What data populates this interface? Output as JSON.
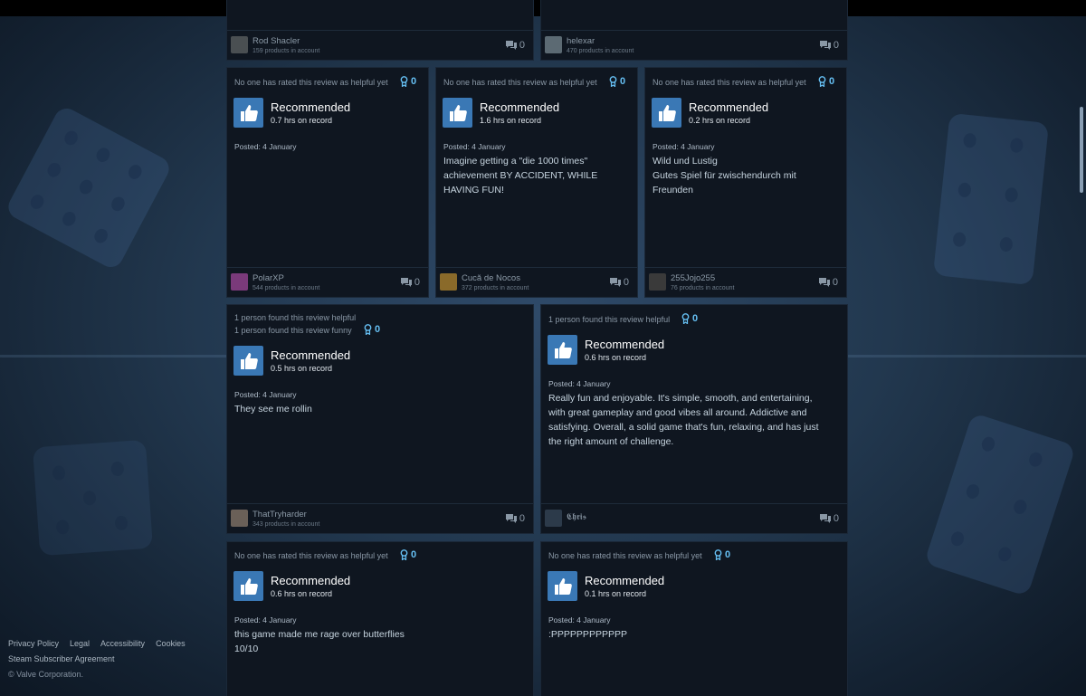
{
  "colors": {
    "accent": "#66c0f4",
    "thumb_bg": "#3a78b5",
    "card_bg": "#0f1620"
  },
  "top_cards": [
    {
      "user": "Rod Shacler",
      "products": "159 products in account",
      "comments": "0"
    },
    {
      "user": "helexar",
      "products": "470 products in account",
      "comments": "0"
    }
  ],
  "row1": [
    {
      "helpful": "No one has rated this review as helpful yet",
      "awards": "0",
      "recommendation": "Recommended",
      "hours": "0.7 hrs on record",
      "posted": "Posted: 4 January",
      "text": "",
      "user": "PolarXP",
      "products": "544 products in account",
      "comments": "0"
    },
    {
      "helpful": "No one has rated this review as helpful yet",
      "awards": "0",
      "recommendation": "Recommended",
      "hours": "1.6 hrs on record",
      "posted": "Posted: 4 January",
      "text": "Imagine getting a \"die 1000 times\"\nachievement BY ACCIDENT, WHILE\nHAVING FUN!",
      "user": "Cucă de Nocos",
      "products": "372 products in account",
      "comments": "0"
    },
    {
      "helpful": "No one has rated this review as helpful yet",
      "awards": "0",
      "recommendation": "Recommended",
      "hours": "0.2 hrs on record",
      "posted": "Posted: 4 January",
      "text": "Wild und Lustig\nGutes Spiel für zwischendurch mit\nFreunden",
      "user": "255Jojo255",
      "products": "76 products in account",
      "comments": "0"
    }
  ],
  "row2": [
    {
      "helpful": "1 person found this review helpful",
      "funny": "1 person found this review funny",
      "awards": "0",
      "recommendation": "Recommended",
      "hours": "0.5 hrs on record",
      "posted": "Posted: 4 January",
      "text": "They see me rollin",
      "user": "ThatTryharder",
      "products": "343 products in account",
      "comments": "0"
    },
    {
      "helpful": "1 person found this review helpful",
      "awards": "0",
      "recommendation": "Recommended",
      "hours": "0.6 hrs on record",
      "posted": "Posted: 4 January",
      "text": "Really fun and enjoyable. It's simple, smooth, and entertaining,\nwith great gameplay and good vibes all around. Addictive and\nsatisfying. Overall, a solid game that's fun, relaxing, and has just\nthe right amount of challenge.",
      "user": "𝕮𝖍𝖗𝖎𝖘",
      "comments": "0"
    }
  ],
  "row3": [
    {
      "helpful": "No one has rated this review as helpful yet",
      "awards": "0",
      "recommendation": "Recommended",
      "hours": "0.6 hrs on record",
      "posted": "Posted: 4 January",
      "text": "this game made me rage over butterflies\n10/10"
    },
    {
      "helpful": "No one has rated this review as helpful yet",
      "awards": "0",
      "recommendation": "Recommended",
      "hours": "0.1 hrs on record",
      "posted": "Posted: 4 January",
      "text": ":PPPPPPPPPPPP"
    }
  ],
  "footer": {
    "links": [
      "Privacy Policy",
      "Legal",
      "Accessibility",
      "Cookies"
    ],
    "subscriber": "Steam Subscriber Agreement",
    "copyright": "© Valve Corporation."
  }
}
